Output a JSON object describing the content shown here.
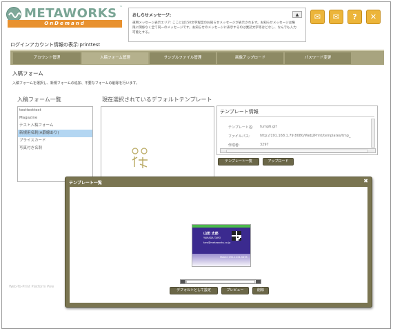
{
  "brand": {
    "name": "METAWORKS",
    "tagline": "OnDemand",
    "trademark": "™"
  },
  "notice": {
    "title": "おしらせメッセージ:",
    "body": "運用メッセージ表示エリア: ここには150文字程度のお知らせメッセージが表示されます。お知らせメッセージは権限に関係なく全て同一のメッセージです。お知らせのメッセージに表示するのは業誌文字等ほどなし、なんでも入力可能とする。",
    "scroll_up": "▲"
  },
  "top_icons": [
    {
      "name": "message",
      "glyph": "✉"
    },
    {
      "name": "mail",
      "glyph": "✉"
    },
    {
      "name": "help",
      "glyph": "?"
    },
    {
      "name": "close",
      "glyph": "✕"
    }
  ],
  "login_info": "ログインアカウント情報の表示:printtest",
  "tabs": [
    "アカウント管理",
    "入稿フォーム管理",
    "サンプルファイル管理",
    "画像アップロード",
    "パスワード変更"
  ],
  "active_tab_index": 1,
  "section": {
    "title": "入稿フォーム",
    "description": "入稿フォームを選択し、新規フォームの追加、不要なフォームの削除を行います。"
  },
  "form_list": {
    "title": "入稿フォーム一覧",
    "items": [
      "testtesttest",
      "Magazine",
      "テスト入稿フォーム",
      "新規用名刺(A罫線あり)",
      "プライスカード",
      "写真付き名刺"
    ],
    "selected_index": 3
  },
  "current_template": {
    "title": "現在選択されているデフォルトテンプレート",
    "thumb_caption": ""
  },
  "template_info": {
    "title": "テンプレート情報",
    "rows": [
      {
        "label": "テンプレート名:",
        "value": "tump6.gif"
      },
      {
        "label": "ファイルパス:",
        "value": "http://191.168.1.79:8080/Web2Print/templates/tmp_"
      },
      {
        "label": "作成者:",
        "value": "3297"
      }
    ]
  },
  "buttons": {
    "template_list": "テンプレート一覧",
    "upload": "アップロード",
    "set_default": "デフォルトとして設定",
    "preview": "プレビュー",
    "delete": "削除"
  },
  "footer": "Web-To-Print Platform Pow",
  "modal": {
    "title": "テンプレート一覧",
    "close": "✖"
  },
  "card": {
    "name": "山田 太郎",
    "sub1": "YAMADA TARO",
    "sub2": "taro@metaworks.co.jp",
    "tel": "Mobile 090-1234-5678"
  },
  "colors": {
    "accent_olive": "#7a7551",
    "brand_orange": "#e8912f",
    "brand_green": "#7aa595",
    "icon_yellow": "#ecb53a"
  }
}
